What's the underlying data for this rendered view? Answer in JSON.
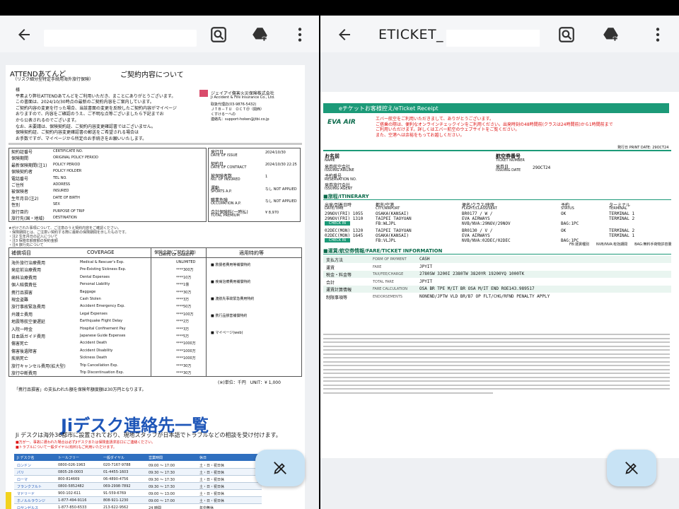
{
  "left_pane": {
    "doc_title_left": "ATTENDあてんど",
    "doc_subtitle_left": "（リスク細分型特定手続用海外旅行保険）",
    "doc_title_right": "ご契約内容について",
    "company_name": "ジェイアイ傷害火災保険株式会社",
    "company_name_en": "Ji Accident & Fire Insurance Co., Ltd.",
    "intro_lines": [
      "様",
      "平素より弊社ATTENDあてんどをご利用いただき、まことにありがとうございます。",
      "この書面は、2024/10/30時点の最新のご契約内容をご案内しています。",
      "ご契約内容の変更を行った場合、当該書面の変更を反映したご契約内容がマイページ",
      "おりますので、内容をご確認のうえ、ご不明な点等ございましたら下記までお",
      "から公表されるのでございます。",
      "なお、未要請は、保険契約証、ご契約内容変更確認書ではございません。",
      "保険契約証、ご契約内容変更確認書の郵送をご希望される場合は",
      "お手数ですが、マイページから所定のお手続きをお願いいたします。"
    ],
    "contact_lines": [
      "取扱代理店(03-9876-5432)",
      "ＪＴＢ－ＴＵ　ＯＣＴ＠（関西）",
      "くすけるーへの",
      "連絡先：support-hoken@jtbi.co.jp"
    ],
    "info_rows": [
      {
        "label": "契約証番号",
        "label_en": "CERTIFICATE NO.",
        "value": ""
      },
      {
        "label": "保険期間",
        "label_en": "ORIGINAL POLICY PERIOD",
        "value": ""
      },
      {
        "label": "最新保険期間(注1)",
        "label_en": "POLICY PERIOD",
        "value": ""
      },
      {
        "label": "保険契約者",
        "label_en": "POLICY HOLDER",
        "value": ""
      },
      {
        "label": "電話番号",
        "label_en": "TEL NO.",
        "value": ""
      },
      {
        "label": "ご住所",
        "label_en": "ADDRESS",
        "value": ""
      },
      {
        "label": "被保険者",
        "label_en": "INSURED",
        "value": ""
      },
      {
        "label": "生年月日(注2)",
        "label_en": "DATE OF BIRTH",
        "value": ""
      },
      {
        "label": "性別",
        "label_en": "SEX",
        "value": ""
      },
      {
        "label": "旅行目的",
        "label_en": "PURPOSE OF TRIP",
        "value": ""
      },
      {
        "label": "旅行先(国・地域)",
        "label_en": "DESTINATION",
        "value": ""
      }
    ],
    "issue_rows": [
      {
        "label": "発行日",
        "label_en": "DATE OF ISSUE",
        "value": "2024/10/30"
      },
      {
        "label": "契約日",
        "label_en": "DATE OF CONTRACT",
        "value": "2024/10/30 22:25"
      },
      {
        "label": "被保険者数",
        "label_en": "NO. OF INSURED",
        "value": "1"
      },
      {
        "label": "運動",
        "label_en": "SPORTS A.P.",
        "value": "なし NOT APPLIED"
      },
      {
        "label": "職業危険",
        "label_en": "OCCUPATION A.P.",
        "value": "なし NOT APPLIED"
      },
      {
        "label": "合計保険料(一時払)",
        "label_en": "TOTAL PREMIUM",
        "value": "¥ 8,970"
      }
    ],
    "coverage_header": {
      "col1": "補償項目",
      "col2": "COVERAGE",
      "col3": "保険金額(ご契約金額)",
      "col3_en": "LIMITS OF LIABILITY",
      "col4": "適用特約等"
    },
    "coverage_rows": [
      {
        "ja": "海外旅行治療費用",
        "en": "Medical & Rescuer's Exp.",
        "limit": "UNLIMITED"
      },
      {
        "ja": "発症前治療費用",
        "en": "Pre-Existing Sickness Exp.",
        "limit": "****300万"
      },
      {
        "ja": "歯科治療費用",
        "en": "Dental Expenses",
        "limit": "****10万"
      },
      {
        "ja": "個人賠償責任",
        "en": "Personal Liability",
        "limit": "****1億"
      },
      {
        "ja": "携行品損害",
        "en": "Baggage",
        "limit": "****30万"
      },
      {
        "ja": "現金盗難",
        "en": "Cash Stolen",
        "limit": "****3万"
      },
      {
        "ja": "旅行事故緊急費用",
        "en": "Accident Emergency Exp.",
        "limit": "****50万"
      },
      {
        "ja": "弁護士費用",
        "en": "Legal Expenses",
        "limit": "****100万"
      },
      {
        "ja": "地震等航空便遅延",
        "en": "Earthquake Flight Delay",
        "limit": "****2万"
      },
      {
        "ja": "入院一時金",
        "en": "Hospital Confinement Pay",
        "limit": "****3万"
      },
      {
        "ja": "日本語ガイド費用",
        "en": "Japanese Guide Expenses",
        "limit": "****5万"
      },
      {
        "ja": "傷害死亡",
        "en": "Accident Death",
        "limit": "****1000万"
      },
      {
        "ja": "傷害後遺障害",
        "en": "Accident Disability",
        "limit": "****1000万"
      },
      {
        "ja": "疾病死亡",
        "en": "Sickness Death",
        "limit": "****1000万"
      },
      {
        "ja": "旅行キャンセル費用(拡大型)",
        "en": "Trip Cancellation Exp.",
        "limit": "****30万"
      },
      {
        "ja": "旅行中断費用",
        "en": "Trip Discontinuation Exp.",
        "limit": "****30万"
      }
    ],
    "coverage_unit": "(※)単位：千円　UNIT：¥ 1,000",
    "coverage_note": "「携行品損害」の支払われた額を保険年額度額は30万円となります。",
    "desk_title": "Jiデスク連絡先一覧",
    "desk_subtitle": "Ji デスクは海外36都市に設置されており、現地スタッフが日本語でトラブルなどの相談を受け付けます。",
    "desk_table_header": [
      "Ji デスク名",
      "トールフリー",
      "一般ダイヤル",
      "営業時間",
      "休日"
    ],
    "desk_rows": [
      [
        "ロンドン",
        "0800-026-1963",
        "020-7167-9788",
        "09:00 ～ 17:00",
        "土・日・祝日休"
      ],
      [
        "パリ",
        "0805-28-0003",
        "01-4455-1603",
        "09:30 ～ 17:30",
        "土・日・祝日休"
      ],
      [
        "ローマ",
        "800-814669",
        "06-4890-4756",
        "09:30 ～ 17:30",
        "土・日・祝日休"
      ],
      [
        "フランクフルト",
        "0800-5852482",
        "069-2998-7892",
        "09:30 ～ 17:30",
        "土・日・祝日休"
      ],
      [
        "マドリード",
        "900-102-611",
        "91-559-6769",
        "09:00 ～ 13:00",
        "土・日・祝日休"
      ],
      [
        "ホノルルラウンジ",
        "1-877-494-9116",
        "808-921-1230",
        "09:00 ～ 17:00",
        "土・日・祝日休"
      ],
      [
        "ロサンゼルス",
        "1-877-850-6533",
        "213-622-9562",
        "24 時間",
        "年中無休"
      ]
    ]
  },
  "right_pane": {
    "title": "ETICKET_",
    "receipt_title": "eチケットお客様控え/eTicket Receipt",
    "airline": "EVA AIR",
    "notice_lines": [
      "エバー航空をご利用いただきまして、ありがとうございます。",
      "ご搭乗の際は、便利なオンラインチェックインをご利用ください。出発時刻の48時間前(クラスは24時間前)から1時間前まで",
      "ご利用いただけます。詳しくはエバー航空のウェブサイトをご覧ください。",
      "また、空港へは余裕をもってお越しください。"
    ],
    "print_date": "発行日 PRINT DATE: 29OCT24",
    "name_label": "お名前",
    "name_label_en": "NAME",
    "ticket_no_label": "航空券番号",
    "ticket_no_label_en": "TICKET NUMBER",
    "issuing_airline_label": "発券航空会社",
    "issuing_airline_label_en": "ISSUING AIRLINE",
    "issue_date_label": "発券日",
    "issue_date_label_en": "ISSUING DATE",
    "issue_date_value": "29OCT24",
    "booking_ref_label": "予約番号",
    "booking_ref_label_en": "RESERVATION NO.",
    "issuing_agent_label": "発券旅行会社",
    "issuing_agent_label_en": "ISSUING AGENT",
    "itinerary_title": "■旅程/ITINERARY",
    "itinerary_header": {
      "date": "出発/到着日時",
      "date_en": "DATE/TIME",
      "city": "都市/空港",
      "city_en": "CITY/AIRPORT",
      "flight": "便名/クラス/座席",
      "flight_en": "FLIGHT/CLASS/SEAT",
      "status": "予約",
      "status_en": "STATUS",
      "terminal": "ターミナル",
      "terminal_en": "TERMINAL"
    },
    "segments": [
      {
        "dep": "29NOV(FRI) 1055",
        "dep_city": "OSAKA(KANSAI)",
        "arr": "29NOV(FRI) 1310",
        "arr_city": "TAIPEI TAOYUAN",
        "flight": "BR0177 / W /",
        "carrier": "EVA AIRWAYS",
        "status": "OK",
        "dep_terminal": "TERMINAL 1",
        "arr_terminal": "TERMINAL 2",
        "fb": "FB:WLJPL",
        "nvb": "NVB/NVA:29NOV/29NOV",
        "bag": "BAG:1PC",
        "checkin": "CHECK IN"
      },
      {
        "dep": "02DEC(MON) 1320",
        "dep_city": "TAIPEI TAOYUAN",
        "arr": "02DEC(MON) 1645",
        "arr_city": "OSAKA(KANSAI)",
        "flight": "BR0130 / V /",
        "carrier": "EVA AIRWAYS",
        "status": "OK",
        "dep_terminal": "TERMINAL 2",
        "arr_terminal": "TERMINAL 1",
        "fb": "FB:VLJPL",
        "nvb": "NVB/NVA:02DEC/02DEC",
        "bag": "BAG:1PC",
        "checkin": "CHECK IN"
      }
    ],
    "legend_note": "FB:運賃種別　　NVB/NVA:有効期間　　BAG:無料手荷物許容量",
    "fare_title": "■運賃/航空券情報/FARE/TICKET INFORMATION",
    "fare_rows": [
      {
        "label": "支払方法",
        "label_en": "FORM OF PAYMENT",
        "value": "CASH"
      },
      {
        "label": "運賃",
        "label_en": "FARE",
        "value": "JPYIT"
      },
      {
        "label": "税金・料金等",
        "label_en": "TAX/FEE/CHARGE",
        "value": "2780SW  3200I  2380TW  3820YR  19200YQ  1000TK"
      },
      {
        "label": "合計",
        "label_en": "TOTAL FARE",
        "value": "JPYIT"
      },
      {
        "label": "運賃計算情報",
        "label_en": "FARE CALCULATION",
        "value": "OSA BR TPE M/IT BR OSA M/IT END ROE143.989517"
      },
      {
        "label": "制限事項等",
        "label_en": "ENDORSEMENTS",
        "value": "NONEND/JPTW VLD BR/B7 OP FLT/CHG/RFND PENALTY APPLY"
      }
    ]
  },
  "fab_label": "edit"
}
